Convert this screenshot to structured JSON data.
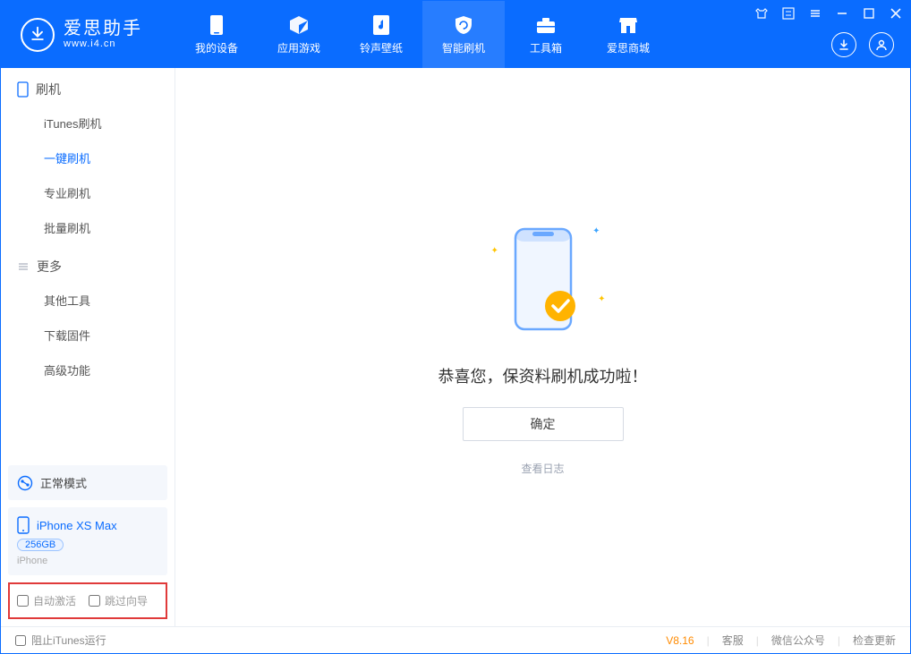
{
  "app": {
    "title": "爱思助手",
    "subtitle": "www.i4.cn"
  },
  "nav": {
    "items": [
      {
        "label": "我的设备"
      },
      {
        "label": "应用游戏"
      },
      {
        "label": "铃声壁纸"
      },
      {
        "label": "智能刷机"
      },
      {
        "label": "工具箱"
      },
      {
        "label": "爱思商城"
      }
    ],
    "active_index": 3
  },
  "sidebar": {
    "group1_title": "刷机",
    "group1_items": [
      "iTunes刷机",
      "一键刷机",
      "专业刷机",
      "批量刷机"
    ],
    "group1_active_index": 1,
    "group2_title": "更多",
    "group2_items": [
      "其他工具",
      "下载固件",
      "高级功能"
    ]
  },
  "device_mode": {
    "label": "正常模式"
  },
  "device": {
    "name": "iPhone XS Max",
    "capacity": "256GB",
    "type": "iPhone"
  },
  "options": {
    "auto_activate": "自动激活",
    "skip_guide": "跳过向导"
  },
  "main": {
    "success_message": "恭喜您，保资料刷机成功啦！",
    "ok_button": "确定",
    "view_log": "查看日志"
  },
  "statusbar": {
    "block_itunes": "阻止iTunes运行",
    "version": "V8.16",
    "support": "客服",
    "wechat": "微信公众号",
    "check_update": "检查更新"
  }
}
